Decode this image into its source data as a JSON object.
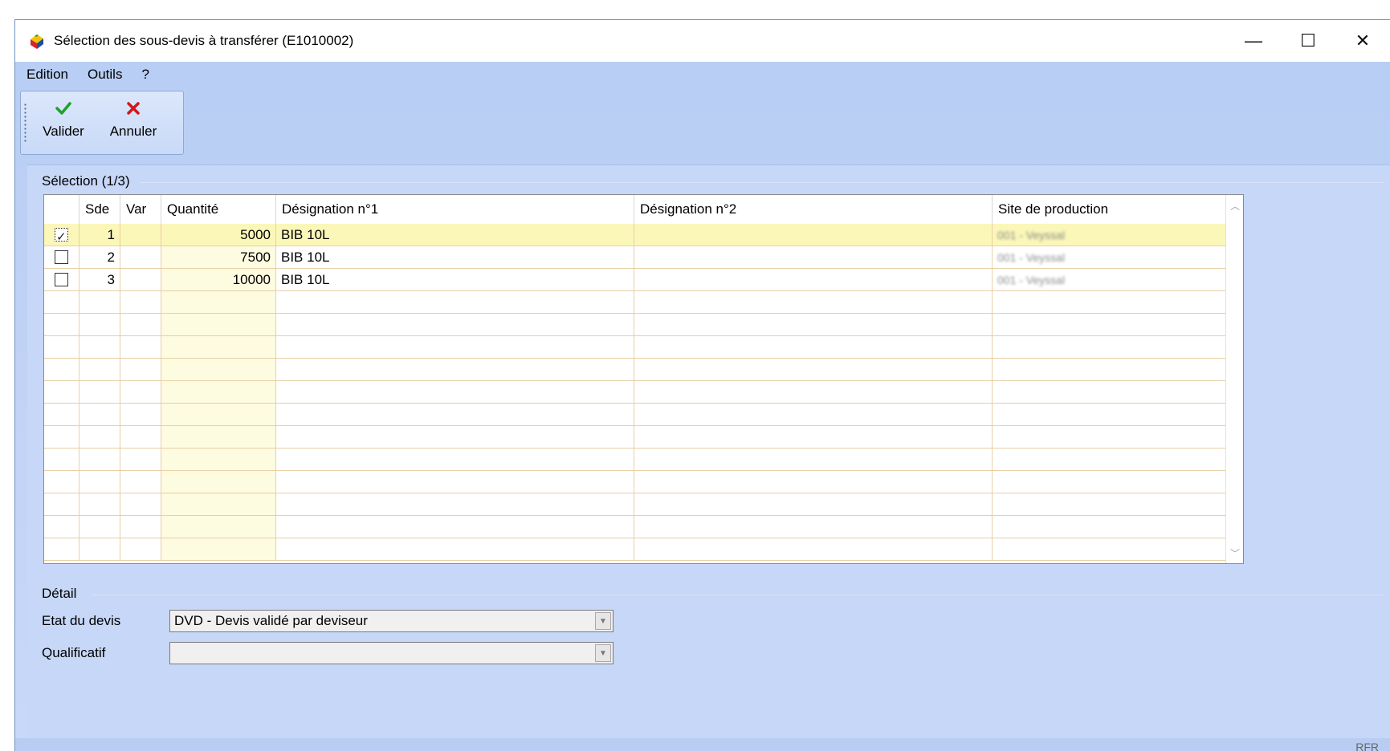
{
  "window": {
    "title": "Sélection des sous-devis à transférer (E1010002)",
    "controls": {
      "minimize": "—",
      "maximize": "☐",
      "close": "✕"
    }
  },
  "menu": [
    {
      "label": "Edition"
    },
    {
      "label": "Outils"
    },
    {
      "label": "?"
    }
  ],
  "toolbar": {
    "valider_label": "Valider",
    "annuler_label": "Annuler",
    "valider_icon": "checkmark-icon",
    "annuler_icon": "red-cross-icon"
  },
  "selection": {
    "group_label": "Sélection (1/3)",
    "columns": [
      "",
      "Sde",
      "Var",
      "Quantité",
      "Désignation n°1",
      "Désignation n°2",
      "Site de production"
    ],
    "rows": [
      {
        "checked": true,
        "sde": "1",
        "var": "",
        "quantite": "5000",
        "designation1": "BIB 10L",
        "designation2": "",
        "site": "001 - Veyssal"
      },
      {
        "checked": false,
        "sde": "2",
        "var": "",
        "quantite": "7500",
        "designation1": "BIB 10L",
        "designation2": "",
        "site": "001 - Veyssal"
      },
      {
        "checked": false,
        "sde": "3",
        "var": "",
        "quantite": "10000",
        "designation1": "BIB 10L",
        "designation2": "",
        "site": "001 - Veyssal"
      }
    ],
    "empty_row_count": 12
  },
  "detail": {
    "group_label": "Détail",
    "etat_label": "Etat du devis",
    "etat_value": "DVD - Devis validé par deviseur",
    "qualificatif_label": "Qualificatif",
    "qualificatif_value": ""
  },
  "status": {
    "text": "RFR"
  },
  "colors": {
    "selected_row": "#fbf7b8",
    "grid_line": "#e8cfa6",
    "window_bg": "#c7d7f7",
    "accept": "#1fa02a",
    "cancel": "#d01818"
  }
}
